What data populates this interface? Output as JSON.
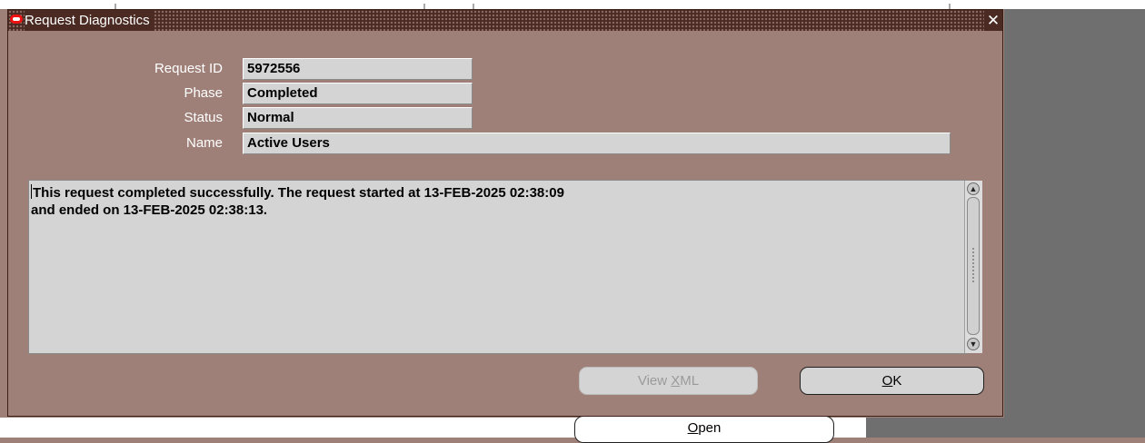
{
  "window": {
    "title": "Request Diagnostics",
    "close_glyph": "✕"
  },
  "fields": {
    "request_id": {
      "label": "Request ID",
      "value": "5972556"
    },
    "phase": {
      "label": "Phase",
      "value": "Completed"
    },
    "status": {
      "label": "Status",
      "value": "Normal"
    },
    "name": {
      "label": "Name",
      "value": "Active Users"
    }
  },
  "message": {
    "line1": "This request completed successfully. The request started at 13-FEB-2025 02:38:09",
    "line2": "and ended on 13-FEB-2025 02:38:13."
  },
  "buttons": {
    "view_xml": {
      "pre": "View ",
      "mnemonic": "X",
      "post": "ML",
      "enabled": false
    },
    "ok": {
      "pre": "",
      "mnemonic": "O",
      "post": "K",
      "enabled": true
    },
    "background_open": {
      "pre": "",
      "mnemonic": "O",
      "post": "pen",
      "enabled": true
    }
  },
  "scrollbar": {
    "up_glyph": "▲",
    "down_glyph": "▼"
  },
  "icons": {
    "app_logo": "oracle-logo-icon",
    "close": "close-icon",
    "scroll_up": "chevron-up-icon",
    "scroll_down": "chevron-down-icon"
  },
  "colors": {
    "window_bg": "#9f8079",
    "titlebar_bg": "#4a2a22",
    "field_bg": "#d4d4d4",
    "logo_red": "#ee1111"
  }
}
